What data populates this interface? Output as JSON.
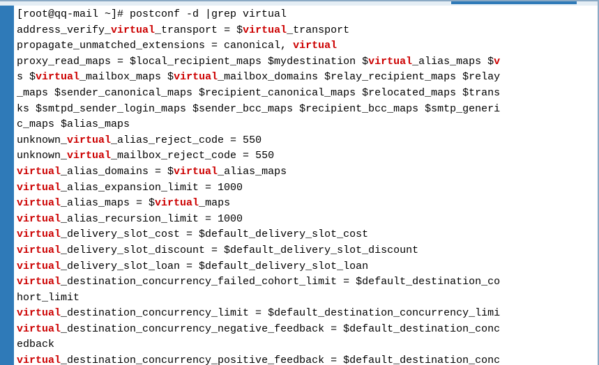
{
  "prompt": "[root@qq-mail ~]# postconf -d |grep virtual",
  "lines": [
    [
      {
        "t": "address_verify_"
      },
      {
        "t": "virtual",
        "hl": true
      },
      {
        "t": "_transport = $"
      },
      {
        "t": "virtual",
        "hl": true
      },
      {
        "t": "_transport"
      }
    ],
    [
      {
        "t": "propagate_unmatched_extensions = canonical, "
      },
      {
        "t": "virtual",
        "hl": true
      }
    ],
    [
      {
        "t": "proxy_read_maps = $local_recipient_maps $mydestination $"
      },
      {
        "t": "virtual",
        "hl": true
      },
      {
        "t": "_alias_maps $"
      },
      {
        "t": "v",
        "hl": true
      }
    ],
    [
      {
        "t": "s $"
      },
      {
        "t": "virtual",
        "hl": true
      },
      {
        "t": "_mailbox_maps $"
      },
      {
        "t": "virtual",
        "hl": true
      },
      {
        "t": "_mailbox_domains $relay_recipient_maps $relay"
      }
    ],
    [
      {
        "t": "_maps $sender_canonical_maps $recipient_canonical_maps $relocated_maps $trans"
      }
    ],
    [
      {
        "t": "ks $smtpd_sender_login_maps $sender_bcc_maps $recipient_bcc_maps $smtp_generi"
      }
    ],
    [
      {
        "t": "c_maps $alias_maps"
      }
    ],
    [
      {
        "t": "unknown_"
      },
      {
        "t": "virtual",
        "hl": true
      },
      {
        "t": "_alias_reject_code = 550"
      }
    ],
    [
      {
        "t": "unknown_"
      },
      {
        "t": "virtual",
        "hl": true
      },
      {
        "t": "_mailbox_reject_code = 550"
      }
    ],
    [
      {
        "t": "virtual",
        "hl": true
      },
      {
        "t": "_alias_domains = $"
      },
      {
        "t": "virtual",
        "hl": true
      },
      {
        "t": "_alias_maps"
      }
    ],
    [
      {
        "t": "virtual",
        "hl": true
      },
      {
        "t": "_alias_expansion_limit = 1000"
      }
    ],
    [
      {
        "t": "virtual",
        "hl": true
      },
      {
        "t": "_alias_maps = $"
      },
      {
        "t": "virtual",
        "hl": true
      },
      {
        "t": "_maps"
      }
    ],
    [
      {
        "t": "virtual",
        "hl": true
      },
      {
        "t": "_alias_recursion_limit = 1000"
      }
    ],
    [
      {
        "t": "virtual",
        "hl": true
      },
      {
        "t": "_delivery_slot_cost = $default_delivery_slot_cost"
      }
    ],
    [
      {
        "t": "virtual",
        "hl": true
      },
      {
        "t": "_delivery_slot_discount = $default_delivery_slot_discount"
      }
    ],
    [
      {
        "t": "virtual",
        "hl": true
      },
      {
        "t": "_delivery_slot_loan = $default_delivery_slot_loan"
      }
    ],
    [
      {
        "t": "virtual",
        "hl": true
      },
      {
        "t": "_destination_concurrency_failed_cohort_limit = $default_destination_co"
      }
    ],
    [
      {
        "t": "hort_limit"
      }
    ],
    [
      {
        "t": "virtual",
        "hl": true
      },
      {
        "t": "_destination_concurrency_limit = $default_destination_concurrency_limi"
      }
    ],
    [
      {
        "t": "virtual",
        "hl": true
      },
      {
        "t": "_destination_concurrency_negative_feedback = $default_destination_conc"
      }
    ],
    [
      {
        "t": "edback"
      }
    ],
    [
      {
        "t": "virtual",
        "hl": true
      },
      {
        "t": "_destination_concurrency_positive_feedback = $default_destination_conc"
      }
    ]
  ]
}
